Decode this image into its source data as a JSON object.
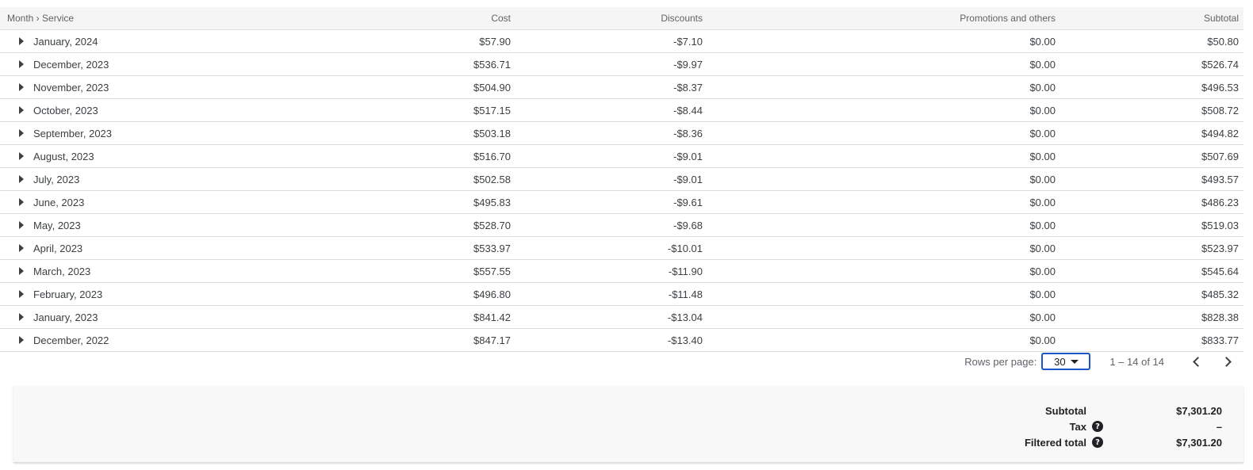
{
  "table": {
    "columns": [
      "Month › Service",
      "Cost",
      "Discounts",
      "Promotions and others",
      "Subtotal"
    ],
    "rows": [
      {
        "month": "January, 2024",
        "cost": "$57.90",
        "discounts": "-$7.10",
        "promotions": "$0.00",
        "subtotal": "$50.80"
      },
      {
        "month": "December, 2023",
        "cost": "$536.71",
        "discounts": "-$9.97",
        "promotions": "$0.00",
        "subtotal": "$526.74"
      },
      {
        "month": "November, 2023",
        "cost": "$504.90",
        "discounts": "-$8.37",
        "promotions": "$0.00",
        "subtotal": "$496.53"
      },
      {
        "month": "October, 2023",
        "cost": "$517.15",
        "discounts": "-$8.44",
        "promotions": "$0.00",
        "subtotal": "$508.72"
      },
      {
        "month": "September, 2023",
        "cost": "$503.18",
        "discounts": "-$8.36",
        "promotions": "$0.00",
        "subtotal": "$494.82"
      },
      {
        "month": "August, 2023",
        "cost": "$516.70",
        "discounts": "-$9.01",
        "promotions": "$0.00",
        "subtotal": "$507.69"
      },
      {
        "month": "July, 2023",
        "cost": "$502.58",
        "discounts": "-$9.01",
        "promotions": "$0.00",
        "subtotal": "$493.57"
      },
      {
        "month": "June, 2023",
        "cost": "$495.83",
        "discounts": "-$9.61",
        "promotions": "$0.00",
        "subtotal": "$486.23"
      },
      {
        "month": "May, 2023",
        "cost": "$528.70",
        "discounts": "-$9.68",
        "promotions": "$0.00",
        "subtotal": "$519.03"
      },
      {
        "month": "April, 2023",
        "cost": "$533.97",
        "discounts": "-$10.01",
        "promotions": "$0.00",
        "subtotal": "$523.97"
      },
      {
        "month": "March, 2023",
        "cost": "$557.55",
        "discounts": "-$11.90",
        "promotions": "$0.00",
        "subtotal": "$545.64"
      },
      {
        "month": "February, 2023",
        "cost": "$496.80",
        "discounts": "-$11.48",
        "promotions": "$0.00",
        "subtotal": "$485.32"
      },
      {
        "month": "January, 2023",
        "cost": "$841.42",
        "discounts": "-$13.04",
        "promotions": "$0.00",
        "subtotal": "$828.38"
      },
      {
        "month": "December, 2022",
        "cost": "$847.17",
        "discounts": "-$13.40",
        "promotions": "$0.00",
        "subtotal": "$833.77"
      }
    ]
  },
  "pagination": {
    "rows_per_page_label": "Rows per page:",
    "rows_per_page_value": "30",
    "range_text": "1 – 14 of 14",
    "prev_icon": "chevron-left-icon",
    "next_icon": "chevron-right-icon"
  },
  "summary": {
    "subtotal_label": "Subtotal",
    "subtotal_value": "$7,301.20",
    "tax_label": "Tax",
    "tax_value": "–",
    "filtered_total_label": "Filtered total",
    "filtered_total_value": "$7,301.20",
    "help_icon": "help-circle-icon"
  },
  "colors": {
    "header_bg": "#f5f5f5",
    "select_border": "#1a56c9",
    "summary_bg": "#f8f8f8",
    "divider": "#dadce0"
  }
}
